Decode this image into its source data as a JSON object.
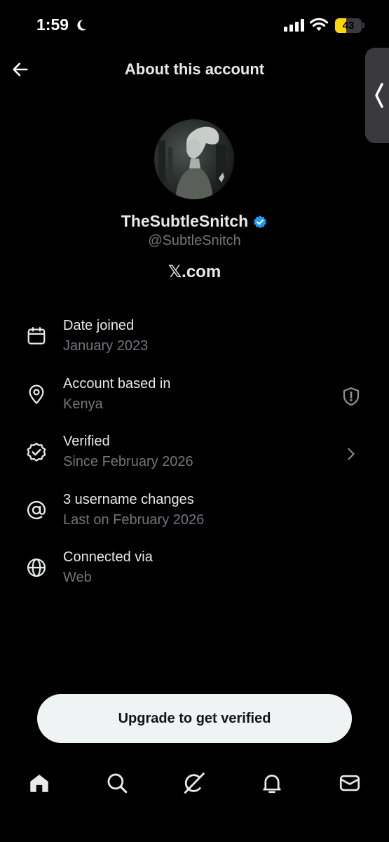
{
  "status_bar": {
    "time": "1:59",
    "battery_level": "43",
    "battery_fraction": 0.43,
    "battery_color": "#ffd60a"
  },
  "header": {
    "title": "About this account"
  },
  "profile": {
    "display_name": "TheSubtleSnitch",
    "handle": "@SubtleSnitch",
    "site": "𝕏.com",
    "verified_badge_color": "#1d9bf0"
  },
  "info_rows": [
    {
      "icon": "calendar-icon",
      "title": "Date joined",
      "subtitle": "January 2023"
    },
    {
      "icon": "location-pin-icon",
      "title": "Account based in",
      "subtitle": "Kenya",
      "trailing_icon": "shield-alert-icon"
    },
    {
      "icon": "verified-check-icon",
      "title": "Verified",
      "subtitle": "Since February 2026",
      "trailing_icon": "chevron-right-icon"
    },
    {
      "icon": "at-sign-icon",
      "title": "3 username changes",
      "subtitle": "Last on February 2026"
    },
    {
      "icon": "globe-icon",
      "title": "Connected via",
      "subtitle": "Web"
    }
  ],
  "upgrade_button": {
    "label": "Upgrade to get verified"
  },
  "bottom_nav": [
    {
      "icon": "home-icon",
      "active": true
    },
    {
      "icon": "search-icon"
    },
    {
      "icon": "grok-icon"
    },
    {
      "icon": "notifications-bell-icon"
    },
    {
      "icon": "messages-envelope-icon"
    }
  ],
  "colors": {
    "background": "#000000",
    "primary_text": "#e7e9ea",
    "secondary_text": "#71767b",
    "button_bg": "#eff3f4"
  }
}
